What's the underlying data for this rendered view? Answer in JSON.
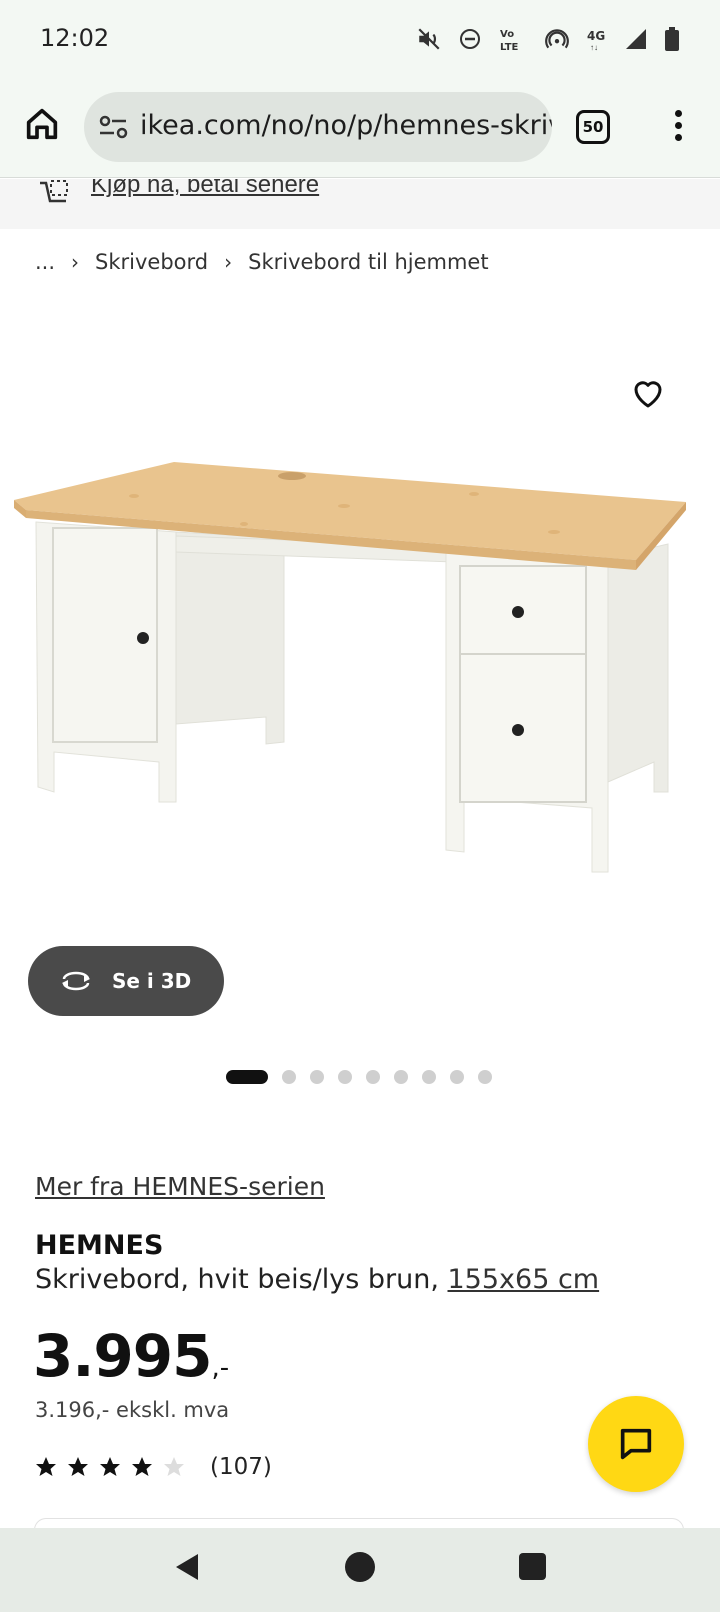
{
  "status_bar": {
    "time": "12:02",
    "icons": [
      "mute-icon",
      "dnd-icon",
      "volte-icon",
      "hotspot-icon",
      "4g-icon",
      "signal-icon",
      "battery-icon"
    ],
    "volte_label": "Vo LTE",
    "network_label": "4G"
  },
  "browser": {
    "url": "ikea.com/no/no/p/hemnes-skrivebord",
    "tab_count": "50"
  },
  "promo": {
    "text": "Kjøp nå, betal senere"
  },
  "breadcrumb": {
    "items": [
      "...",
      "Skrivebord",
      "Skrivebord til hjemmet"
    ]
  },
  "gallery": {
    "view_3d_label": "Se i 3D",
    "slide_count": 9,
    "active_slide": 1
  },
  "product": {
    "series_link": "Mer fra HEMNES-serien",
    "name": "HEMNES",
    "description": "Skrivebord, hvit beis/lys brun,",
    "size": "155x65 cm",
    "price": "3.995",
    "price_suffix": ",-",
    "price_ex_vat": "3.196,- ekskl. mva",
    "rating": 4,
    "rating_max": 5,
    "review_count": "(107)"
  },
  "colors": {
    "chat_button": "#ffd814",
    "button_3d": "#4a4a4a",
    "star_filled": "#111111",
    "star_empty": "#dddddd"
  }
}
